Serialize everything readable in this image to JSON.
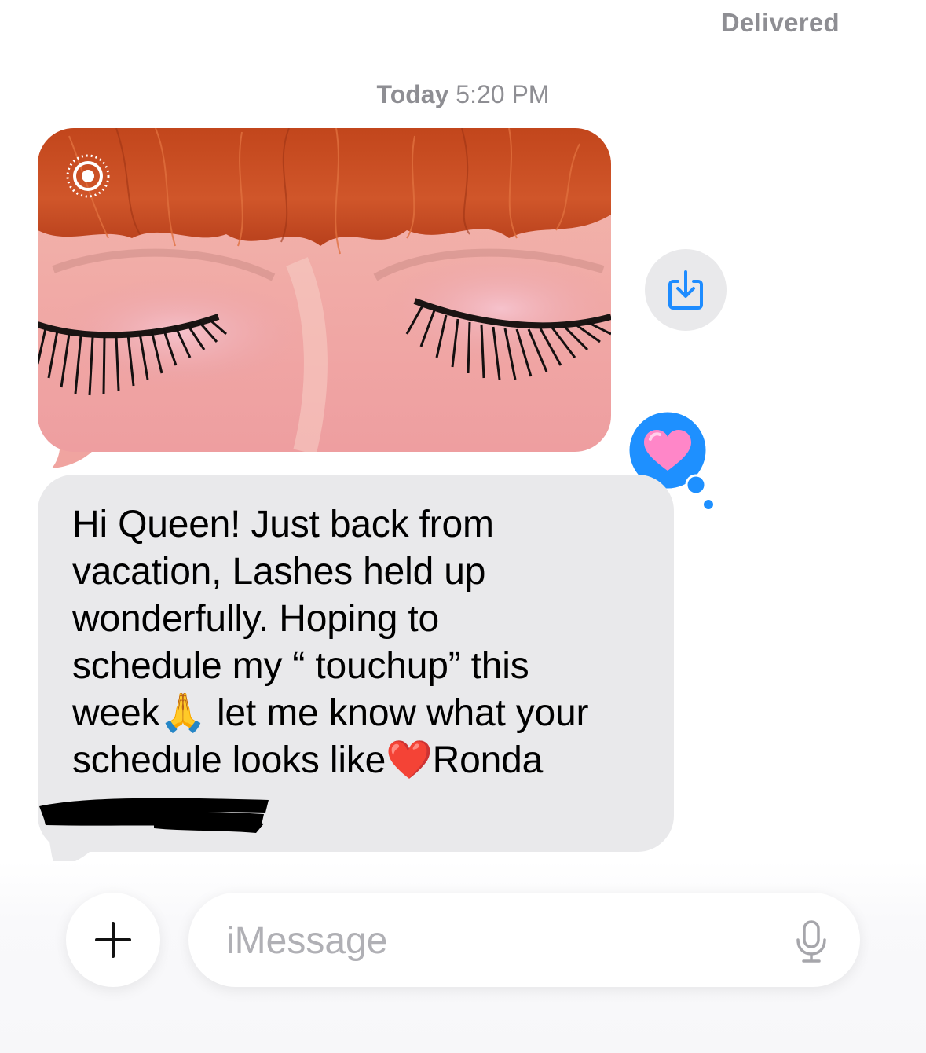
{
  "status": {
    "delivered_label": "Delivered"
  },
  "conversation": {
    "timestamp_day": "Today",
    "timestamp_time": "5:20 PM",
    "incoming_photo": {
      "kind": "live-photo",
      "subject": "eyelash extensions"
    },
    "incoming_message": "Hi Queen! Just back from\nvacation, Lashes held up\nwonderfully. Hoping to\nschedule my “ touchup” this\nweek🙏 let me know what your\nschedule looks like❤️Ronda",
    "tapback_reaction": {
      "icon": "heart-icon",
      "color": "#ff7fc4",
      "bubble_color": "#1e90ff"
    }
  },
  "composer": {
    "placeholder": "iMessage",
    "plus_icon": "plus-icon",
    "mic_icon": "microphone-icon"
  },
  "colors": {
    "incoming_bubble": "#e9e9eb",
    "secondary_text": "#8e8e93",
    "accent": "#1e90ff"
  }
}
